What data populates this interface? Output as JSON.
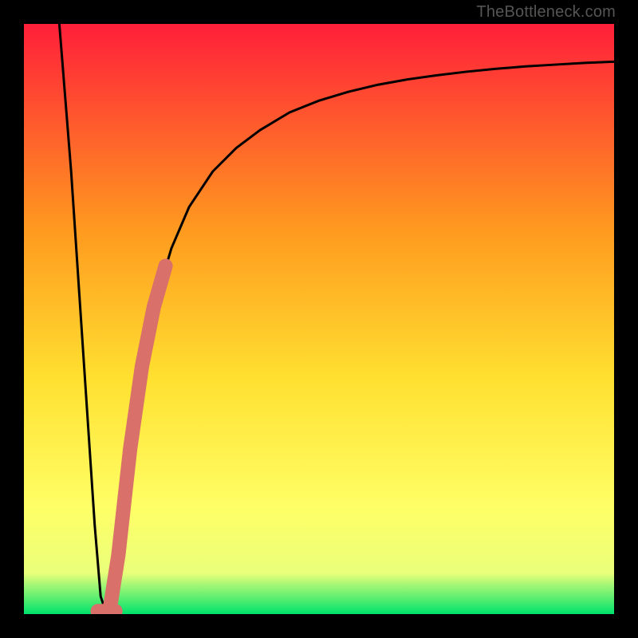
{
  "watermark": "TheBottleneck.com",
  "colors": {
    "gradient_top": "#ff1f3a",
    "gradient_mid1": "#ff9a1f",
    "gradient_mid2": "#ffe030",
    "gradient_mid3": "#ffff66",
    "gradient_low": "#eaff7a",
    "gradient_bottom": "#00e36b",
    "curve": "#000000",
    "highlight": "#d9706a",
    "frame": "#000000"
  },
  "chart_data": {
    "type": "line",
    "title": "",
    "xlabel": "",
    "ylabel": "",
    "xlim": [
      0,
      100
    ],
    "ylim": [
      0,
      100
    ],
    "series": [
      {
        "name": "bottleneck-curve",
        "x": [
          6,
          8,
          10,
          12,
          13,
          14,
          15,
          16,
          18,
          20,
          22,
          25,
          28,
          32,
          36,
          40,
          45,
          50,
          55,
          60,
          65,
          70,
          75,
          80,
          85,
          90,
          95,
          100
        ],
        "y": [
          100,
          75,
          45,
          15,
          3,
          0,
          3,
          10,
          28,
          42,
          52,
          62,
          69,
          75,
          79,
          82,
          85,
          87,
          88.5,
          89.7,
          90.6,
          91.3,
          91.9,
          92.4,
          92.8,
          93.1,
          93.4,
          93.6
        ]
      }
    ],
    "min_point": {
      "x": 14,
      "y": 0
    },
    "highlight_segment": {
      "note": "thick salmon overlay on ascending branch near the minimum",
      "x": [
        14.5,
        16,
        18,
        20,
        22,
        24
      ],
      "y": [
        0.5,
        10,
        28,
        42,
        52,
        59
      ]
    },
    "highlight_nub": {
      "note": "short horizontal salmon nub at the minimum",
      "x": [
        12.5,
        15.5
      ],
      "y": [
        0.5,
        0.5
      ]
    }
  }
}
